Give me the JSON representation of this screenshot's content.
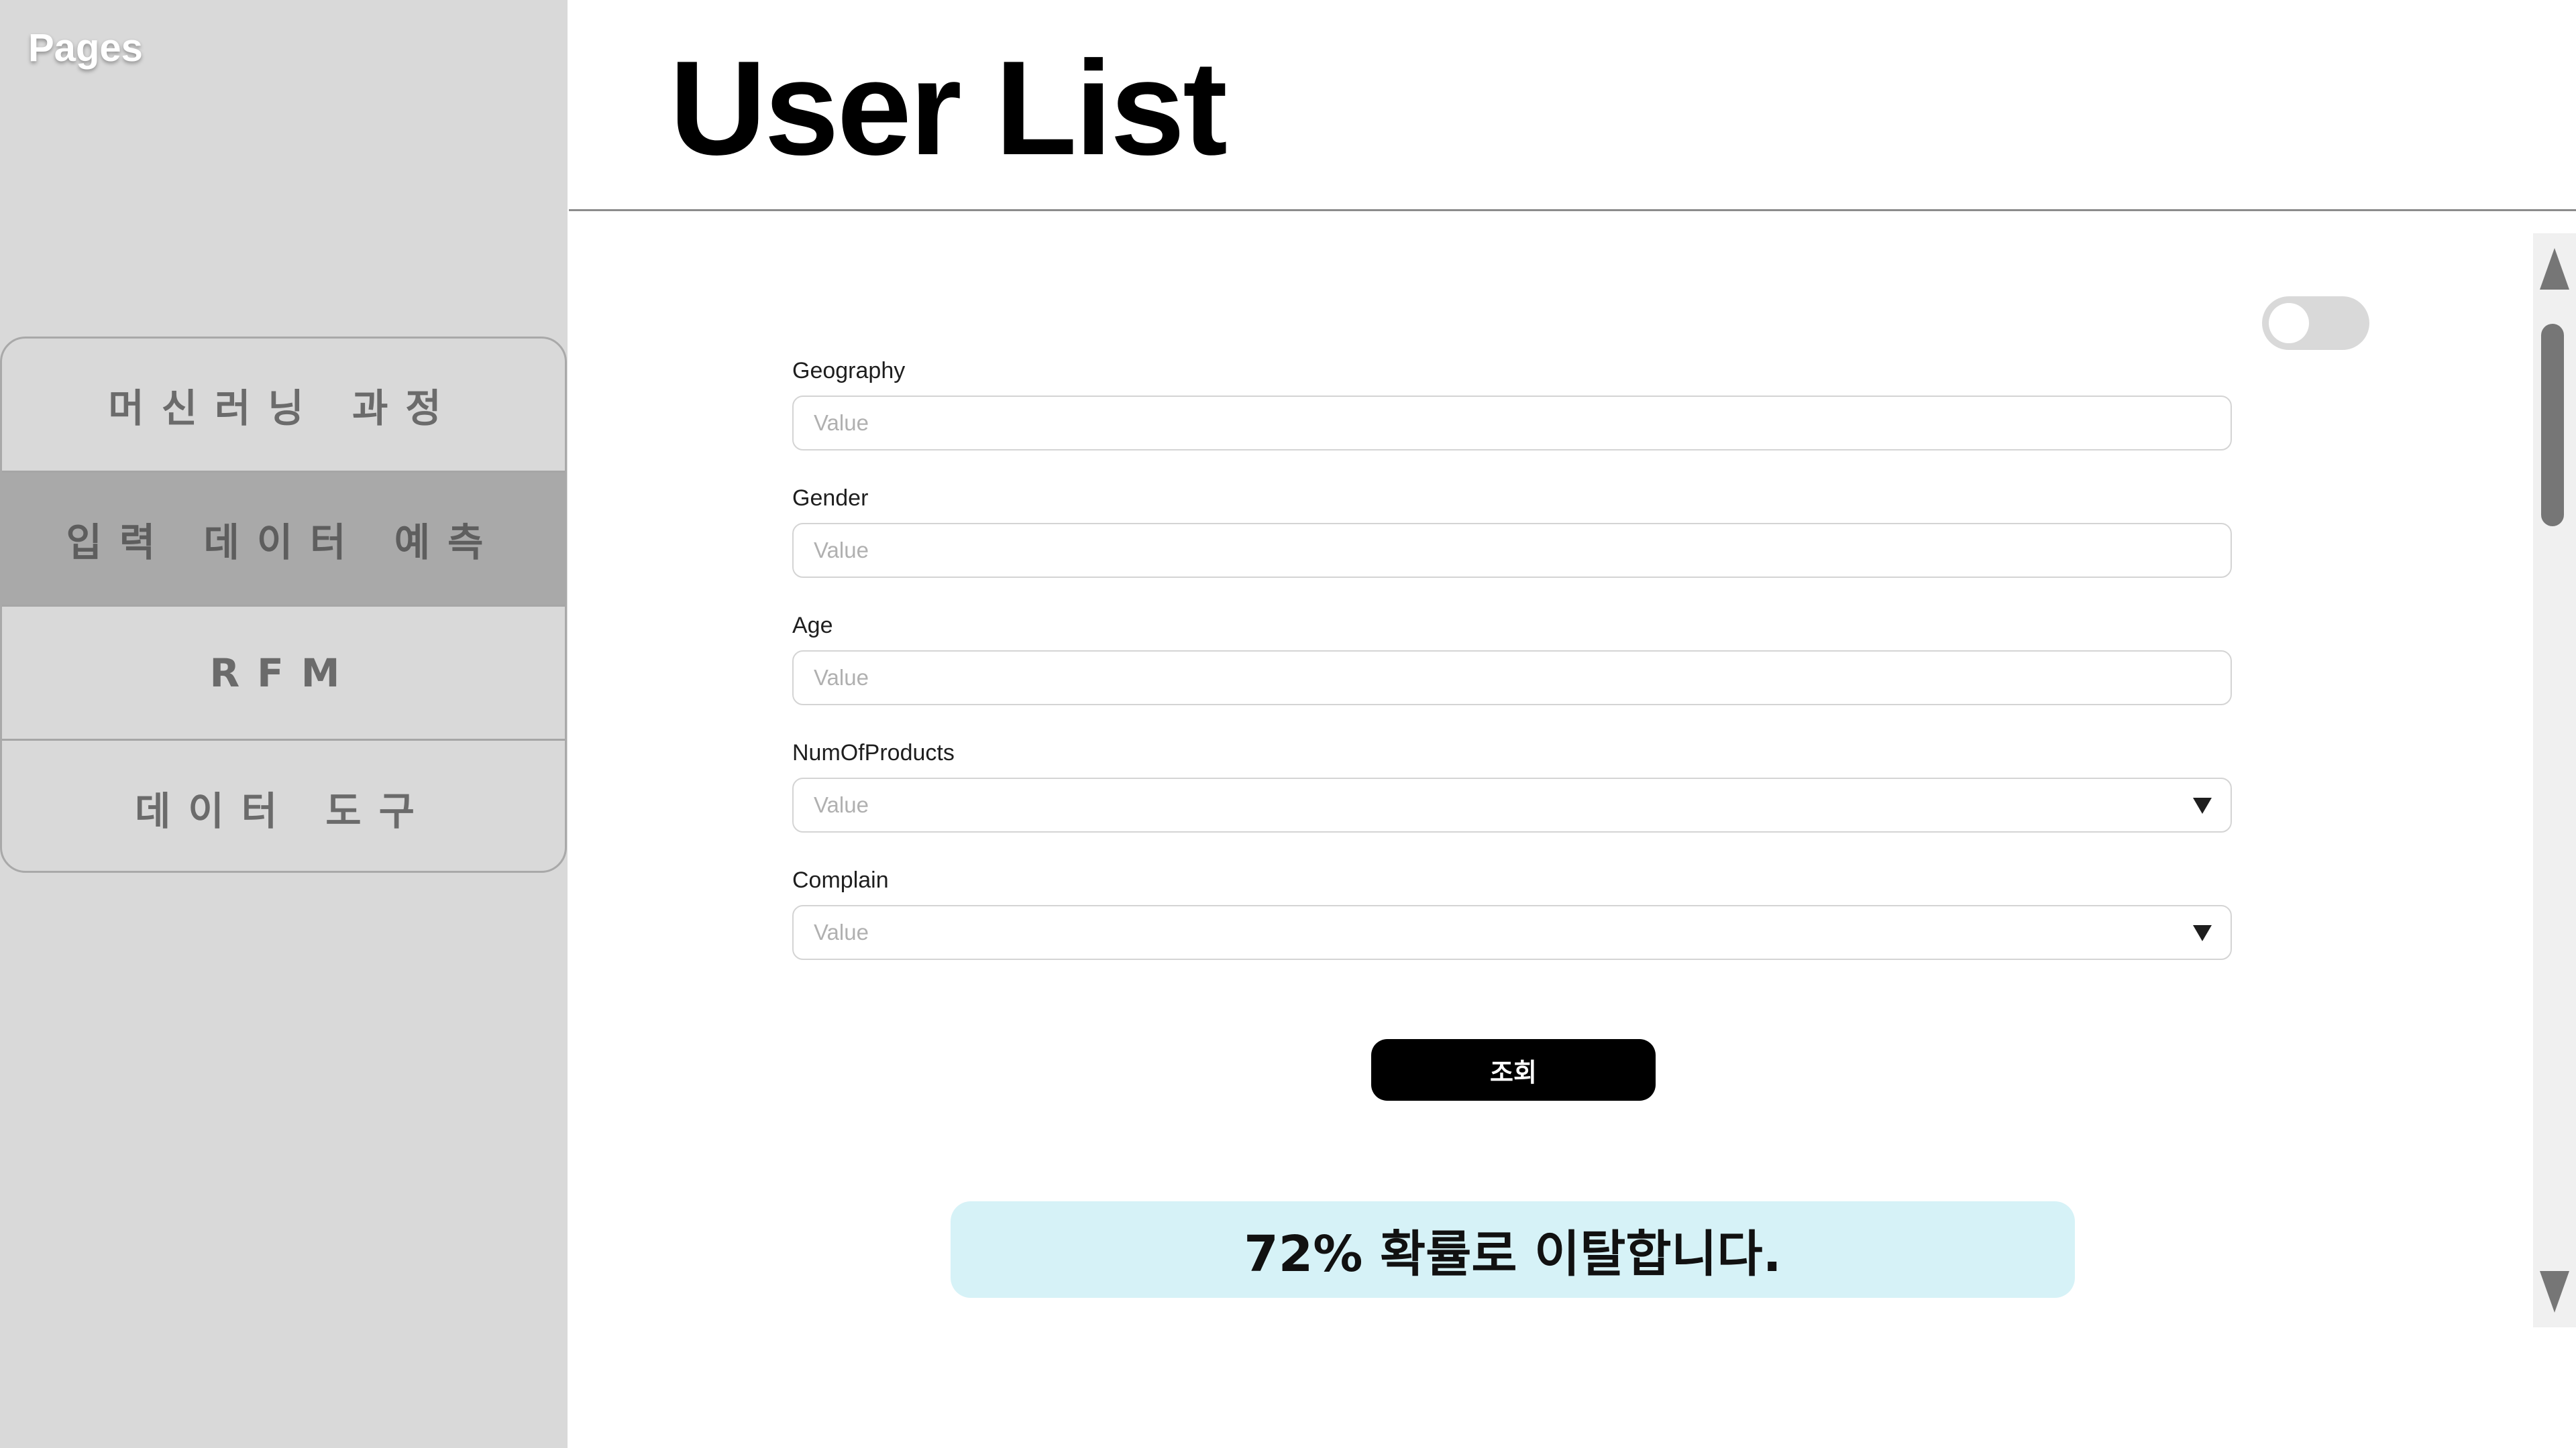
{
  "sidebar": {
    "title": "Pages",
    "items": [
      {
        "label": "머신러닝 과정",
        "active": false
      },
      {
        "label": "입력 데이터 예측",
        "active": true
      },
      {
        "label": "RFM",
        "active": false
      },
      {
        "label": "데이터 도구",
        "active": false
      }
    ]
  },
  "header": {
    "title": "User List"
  },
  "toggle": {
    "state": "off"
  },
  "form": {
    "fields": [
      {
        "label": "Geography",
        "placeholder": "Value",
        "type": "text"
      },
      {
        "label": "Gender",
        "placeholder": "Value",
        "type": "text"
      },
      {
        "label": "Age",
        "placeholder": "Value",
        "type": "text"
      },
      {
        "label": "NumOfProducts",
        "placeholder": "Value",
        "type": "select"
      },
      {
        "label": "Complain",
        "placeholder": "Value",
        "type": "select"
      }
    ],
    "submit_label": "조회"
  },
  "result": {
    "text": "72% 확률로 이탈합니다."
  },
  "icons": {
    "dropdown": "chevron-down-icon",
    "scroll_up": "arrow-up-icon",
    "scroll_down": "arrow-down-icon"
  },
  "colors": {
    "sidebar_bg": "#d9d9d9",
    "nav_active_bg": "#a9a9a9",
    "button_bg": "#000000",
    "result_bg": "#d6f2f7"
  }
}
